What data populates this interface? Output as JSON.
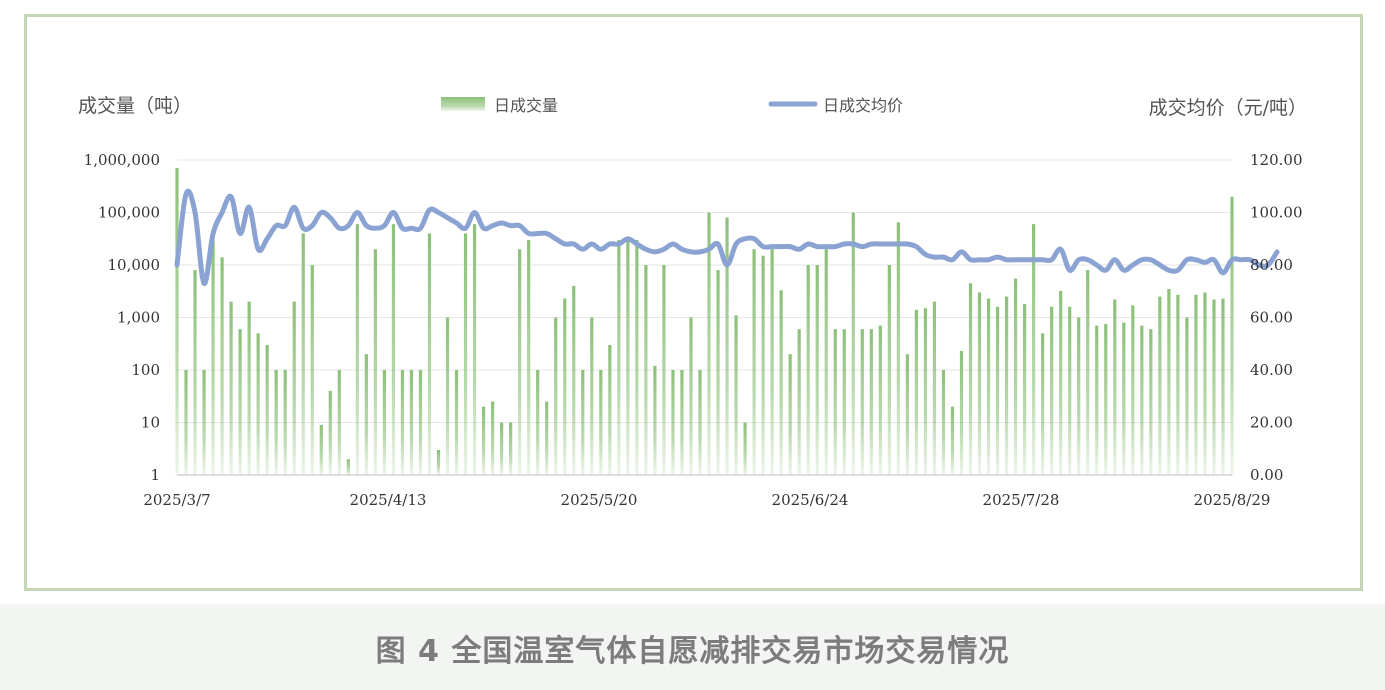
{
  "caption": "图 4  全国温室气体自愿减排交易市场交易情况",
  "colors": {
    "bar": "#8cc079",
    "line": "#8aa3d2",
    "grid": "#e6e6e6",
    "frame": "#c4d6b8"
  },
  "chart_data": {
    "type": "bar",
    "yscale_left": "log",
    "left_axis_label": "成交量（吨）",
    "right_axis_label": "成交均价（元/吨）",
    "legend": {
      "bar": "日成交量",
      "line": "日成交均价",
      "placement": "top"
    },
    "ylim_left": [
      1,
      1000000
    ],
    "ylim_right": [
      0,
      120
    ],
    "left_ticks": [
      "1",
      "10",
      "100",
      "1,000",
      "10,000",
      "100,000",
      "1,000,000"
    ],
    "right_ticks": [
      "0.00",
      "20.00",
      "40.00",
      "60.00",
      "80.00",
      "100.00",
      "120.00"
    ],
    "x_tick_labels": [
      "2025/3/7",
      "2025/4/13",
      "2025/5/20",
      "2025/6/24",
      "2025/7/28",
      "2025/8/29"
    ],
    "grid": true,
    "series": [
      {
        "name": "日成交量",
        "type": "bar",
        "values": [
          700000,
          100,
          8000,
          100,
          30000,
          14000,
          2000,
          600,
          2000,
          500,
          300,
          100,
          100,
          2000,
          40000,
          10000,
          9,
          40,
          100,
          2,
          60000,
          200,
          20000,
          100,
          60000,
          100,
          100,
          100,
          40000,
          3,
          1000,
          100,
          40000,
          60000,
          20,
          25,
          10,
          10,
          20000,
          30000,
          100,
          25,
          1000,
          2300,
          4000,
          100,
          1000,
          100,
          300,
          30000,
          30000,
          30000,
          10000,
          120,
          10000,
          100,
          100,
          1000,
          100,
          100000,
          8000,
          80000,
          1100,
          10,
          20000,
          15000,
          20000,
          3300,
          200,
          600,
          10000,
          10000,
          20000,
          600,
          600,
          100000,
          600,
          600,
          700,
          10000,
          65000,
          200,
          1400,
          1500,
          2000,
          100,
          20,
          230,
          4500,
          3000,
          2300,
          1600,
          2500,
          5500,
          1800,
          60000,
          500,
          1600,
          3200,
          1600,
          1000,
          8000,
          700,
          750,
          2200,
          800,
          1700,
          700,
          600,
          2500,
          3500,
          2700,
          1000,
          2700,
          3000,
          2200,
          2300,
          200000
        ]
      },
      {
        "name": "日成交均价",
        "type": "line",
        "values": [
          80,
          107,
          100,
          73,
          92,
          100,
          106,
          92,
          102,
          86,
          90,
          95,
          95,
          102,
          94,
          95,
          100,
          98,
          94,
          95,
          100,
          95,
          94,
          95,
          100,
          94,
          94,
          94,
          101,
          100,
          98,
          96,
          94,
          100,
          94,
          95,
          96,
          95,
          95,
          92,
          92,
          92,
          90,
          88,
          88,
          86,
          88,
          86,
          88,
          88,
          90,
          88,
          86,
          85,
          86,
          88,
          86,
          85,
          85,
          86,
          88,
          80,
          88,
          90,
          90,
          87,
          87,
          87,
          87,
          86,
          88,
          87,
          87,
          87,
          88,
          88,
          87,
          88,
          88,
          88,
          88,
          88,
          87,
          84,
          83,
          83,
          82,
          85,
          82,
          82,
          82,
          83,
          82,
          82,
          82,
          82,
          82,
          82,
          86,
          78,
          82,
          82,
          80,
          78,
          82,
          78,
          80,
          82,
          82,
          80,
          78,
          78,
          82,
          82,
          81,
          82,
          77,
          82,
          82,
          82,
          80,
          80,
          85
        ]
      }
    ]
  }
}
